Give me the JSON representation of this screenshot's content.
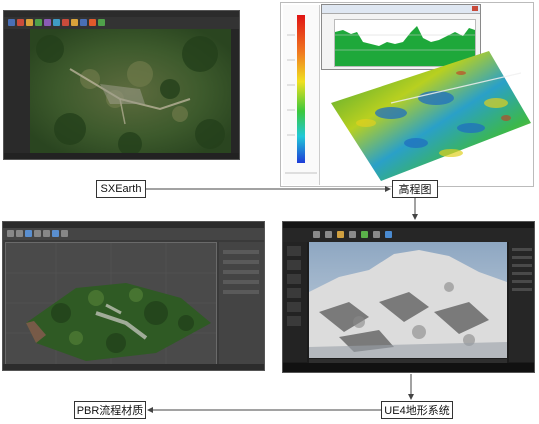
{
  "nodes": {
    "sxearth": "SXEarth",
    "elevation": "高程图",
    "ue4": "UE4地形系统",
    "pbr": "PBR流程材质"
  },
  "colors": {
    "arrow": "#444444",
    "box_border": "#333333",
    "terrain_green": "#2f5a24",
    "snow": "#e6e6e6",
    "sky": "#a9bfd6"
  },
  "icons": [
    "arrow-right-icon",
    "arrow-down-icon",
    "arrow-left-icon"
  ]
}
